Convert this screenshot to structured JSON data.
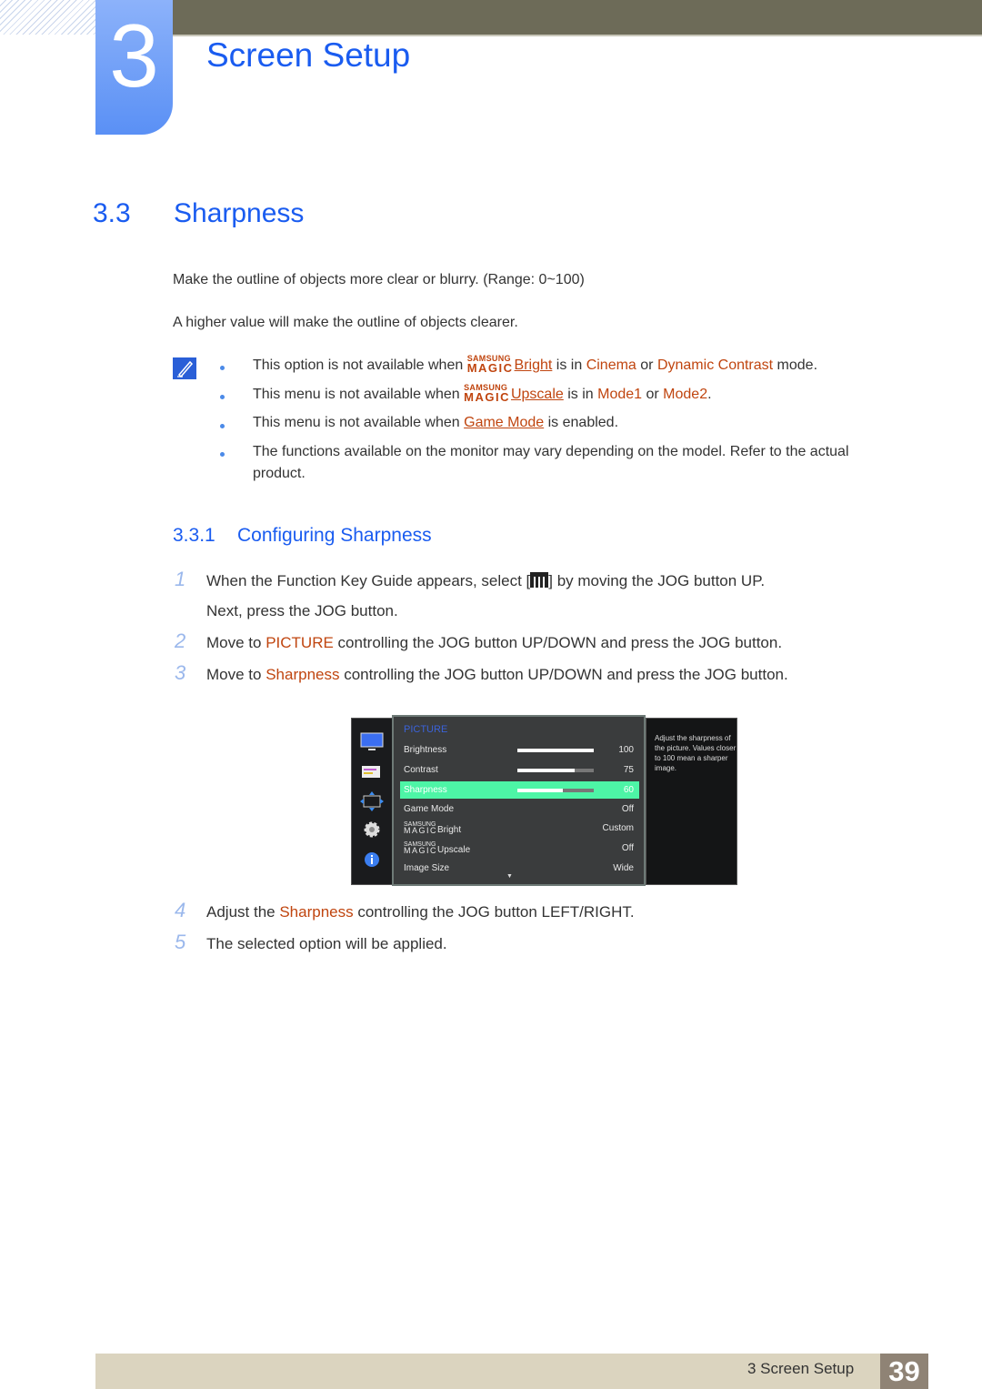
{
  "chapter": {
    "number": "3",
    "title": "Screen Setup"
  },
  "section": {
    "number": "3.3",
    "title": "Sharpness"
  },
  "intro": [
    "Make the outline of objects more clear or blurry. (Range: 0~100)",
    "A higher value will make the outline of objects clearer."
  ],
  "notes": {
    "icon": "note-pencil-icon",
    "items": [
      {
        "pre": "This option is not available when ",
        "magic": {
          "top": "SAMSUNG",
          "bottom": "MAGIC"
        },
        "link": "Bright",
        "mid": " is in ",
        "hl1": "Cinema",
        "or": " or ",
        "hl2": "Dynamic Contrast",
        "post": " mode."
      },
      {
        "pre": "This menu is not available when ",
        "magic": {
          "top": "SAMSUNG",
          "bottom": "MAGIC"
        },
        "link": "Upscale",
        "mid": " is in ",
        "hl1": "Mode1",
        "or": " or ",
        "hl2": "Mode2",
        "post": "."
      },
      {
        "pre": "This menu is not available when ",
        "link": "Game Mode",
        "post": " is enabled."
      },
      {
        "line1": "The functions available on the monitor may vary depending on the model. Refer to the actual",
        "line2": "product."
      }
    ]
  },
  "subsection": {
    "number": "3.3.1",
    "title": "Configuring Sharpness"
  },
  "steps": [
    {
      "num": "1",
      "pre": "When the Function Key Guide appears, select [",
      "post": "] by moving the JOG button UP.",
      "line2": "Next, press the JOG button."
    },
    {
      "num": "2",
      "pre": "Move to ",
      "hl": "PICTURE",
      "post": " controlling the JOG button UP/DOWN and press the JOG button."
    },
    {
      "num": "3",
      "pre": "Move to ",
      "hl": "Sharpness",
      "post": " controlling the JOG button UP/DOWN and press the JOG button."
    },
    {
      "num": "4",
      "pre": "Adjust the ",
      "hl": "Sharpness",
      "post": " controlling the JOG button LEFT/RIGHT."
    },
    {
      "num": "5",
      "pre": "The selected option will be applied."
    }
  ],
  "osd": {
    "title": "PICTURE",
    "side_icons": [
      "monitor-icon",
      "list-icon",
      "resize-arrows-icon",
      "gear-icon",
      "info-icon"
    ],
    "rows": [
      {
        "label": "Brightness",
        "value": "100",
        "level": 1.0
      },
      {
        "label": "Contrast",
        "value": "75",
        "level": 0.75
      },
      {
        "label": "Sharpness",
        "value": "60",
        "level": 0.6,
        "selected": true
      },
      {
        "label": "Game Mode",
        "value": "Off"
      },
      {
        "label": "Bright",
        "magic": true,
        "value": "Custom"
      },
      {
        "label": "Upscale",
        "magic": true,
        "value": "Off"
      },
      {
        "label": "Image Size",
        "value": "Wide"
      }
    ],
    "magic_top": "SAMSUNG",
    "magic_bottom": "MAGIC",
    "scroll_down": "▼",
    "help": "Adjust the sharpness of the picture. Values closer to 100 mean a sharper image.",
    "colors": {
      "selected": "#4df5a6",
      "title": "#3b62d9"
    }
  },
  "footer": {
    "label": "3 Screen Setup",
    "page": "39"
  },
  "colors": {
    "heading": "#1a5cf0",
    "highlight": "#c0450f",
    "topbar": "#6d6b58",
    "footer": "#dbd4bf"
  }
}
